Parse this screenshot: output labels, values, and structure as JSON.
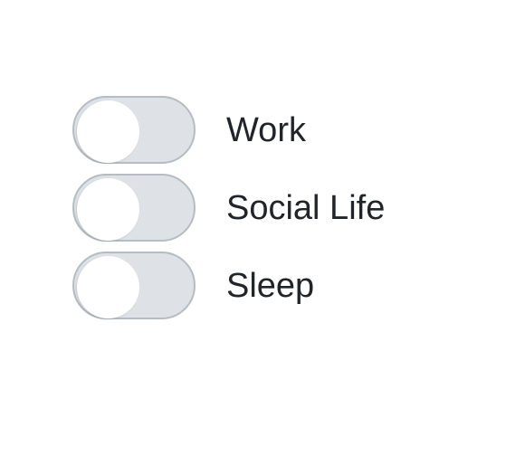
{
  "toggles": [
    {
      "label": "Work",
      "checked": false
    },
    {
      "label": "Social Life",
      "checked": false
    },
    {
      "label": "Sleep",
      "checked": false
    }
  ],
  "colors": {
    "track_off": "#dee2e6",
    "track_border": "#b5bcc3",
    "knob": "#ffffff",
    "label_text": "#212529"
  }
}
